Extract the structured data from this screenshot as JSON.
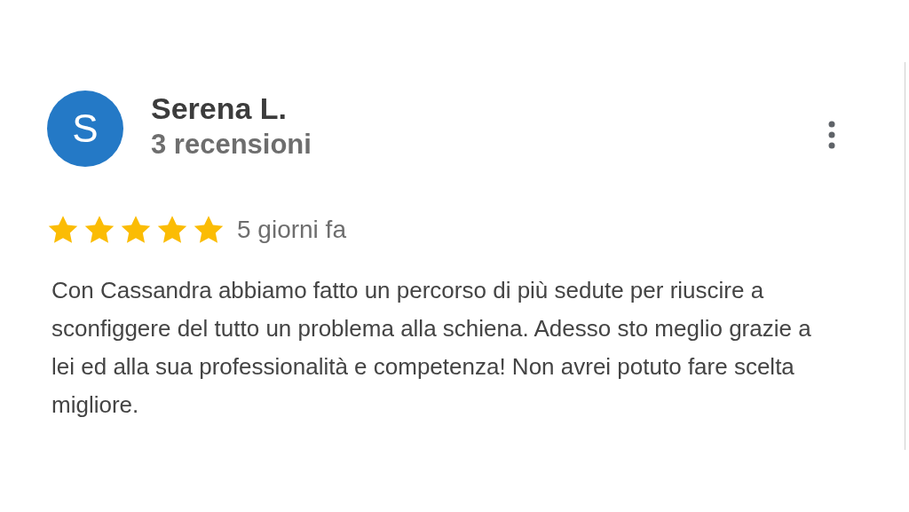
{
  "review": {
    "avatar_letter": "S",
    "author": "Serena L.",
    "review_count": "3 recensioni",
    "stars": 5,
    "time": "5 giorni fa",
    "text": "Con Cassandra abbiamo fatto un percorso di più sedute per riuscire a sconfiggere del tutto un problema alla schiena. Adesso sto meglio grazie a lei ed alla sua professionalità e competenza! Non avrei potuto fare scelta migliore."
  }
}
